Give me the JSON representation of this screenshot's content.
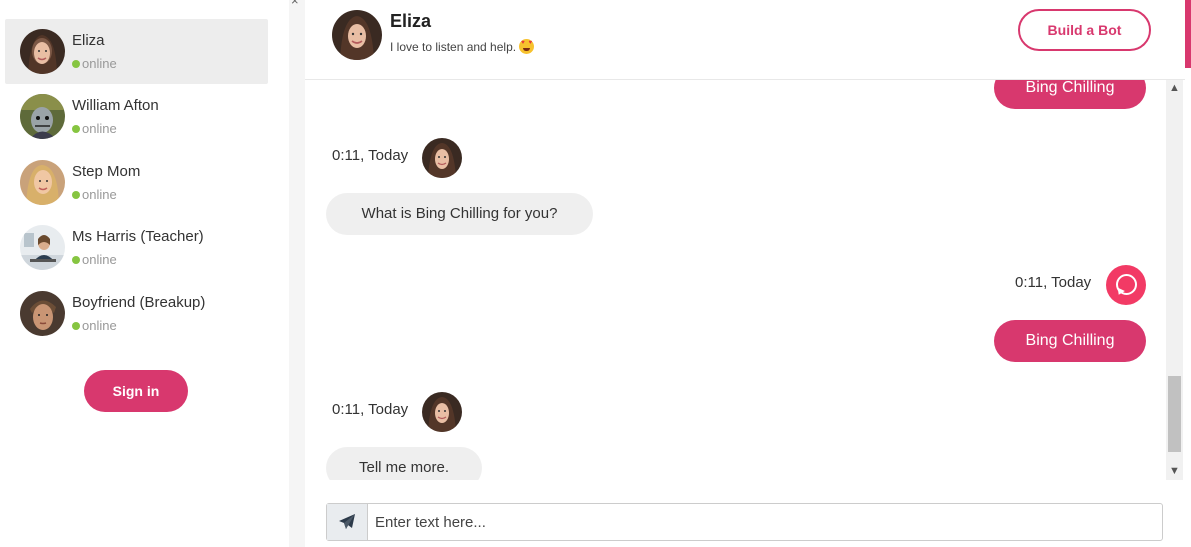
{
  "sidebar": {
    "contacts": [
      {
        "name": "Eliza",
        "status": "online"
      },
      {
        "name": "William Afton",
        "status": "online"
      },
      {
        "name": "Step Mom",
        "status": "online"
      },
      {
        "name": "Ms Harris (Teacher)",
        "status": "online"
      },
      {
        "name": "Boyfriend (Breakup)",
        "status": "online"
      }
    ],
    "sign_in_label": "Sign in",
    "close_glyph": "×"
  },
  "header": {
    "name": "Eliza",
    "subtitle": "I love to listen and help.",
    "build_bot_label": "Build a Bot"
  },
  "messages": [
    {
      "from": "user",
      "text": "Bing Chilling"
    },
    {
      "from": "bot",
      "time": "0:11, Today",
      "text": "What is Bing Chilling for you?"
    },
    {
      "from": "user",
      "time": "0:11, Today",
      "text": "Bing Chilling"
    },
    {
      "from": "bot",
      "time": "0:11, Today",
      "text": "Tell me more."
    }
  ],
  "input": {
    "placeholder": "Enter text here..."
  },
  "colors": {
    "accent": "#d8386e",
    "online": "#86c541",
    "user_icon": "#f23a65"
  },
  "icons": {
    "send": "paper-plane-icon",
    "user": "chat-bubble-icon",
    "scroll_up": "▲",
    "scroll_down": "▼"
  }
}
